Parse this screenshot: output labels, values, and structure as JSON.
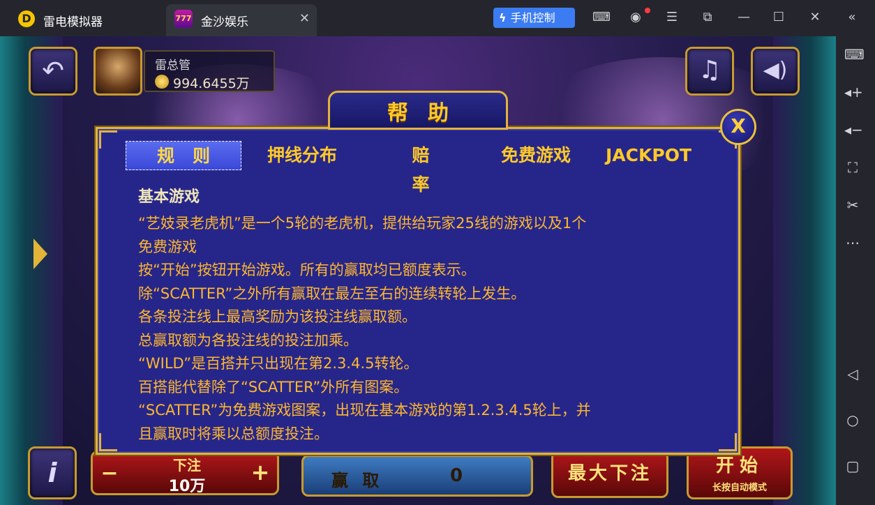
{
  "emulator": {
    "app_name": "雷电模拟器",
    "tab_title": "金沙娱乐",
    "phone_control": "手机控制"
  },
  "game": {
    "player_name": "雷总管",
    "balance": "994.6455万",
    "bottom": {
      "bet_label": "下注",
      "bet_value": "10万",
      "win_label": "赢 取",
      "win_value": "0",
      "max_bet": "最大下注",
      "start": "开始",
      "auto_mode": "长按自动模式"
    }
  },
  "help": {
    "title": "帮助",
    "close_label": "X",
    "tabs": [
      "规则",
      "押线分布",
      "赔率",
      "免费游戏",
      "JACKPOT"
    ],
    "active_tab": 0,
    "heading": "基本游戏",
    "lines": [
      "“艺妓录老虎机”是一个5轮的老虎机，提供给玩家25线的游戏以及1个",
      "免费游戏",
      "按“开始”按钮开始游戏。所有的赢取均已额度表示。",
      "除“SCATTER”之外所有赢取在最左至右的连续转轮上发生。",
      "各条投注线上最高奖励为该投注线赢取额。",
      "总赢取额为各投注线的投注加乘。",
      "“WILD”是百搭并只出现在第2.3.4.5转轮。",
      "百搭能代替除了“SCATTER”外所有图案。",
      "“SCATTER”为免费游戏图案，出现在基本游戏的第1.2.3.4.5轮上，并",
      "且赢取时将乘以总额度投注。"
    ]
  },
  "colors": {
    "dialog_bg": "#26268a",
    "gold": "#e2b43a",
    "body_text": "#ffb72e",
    "accent_blue": "#3c7cf2"
  }
}
